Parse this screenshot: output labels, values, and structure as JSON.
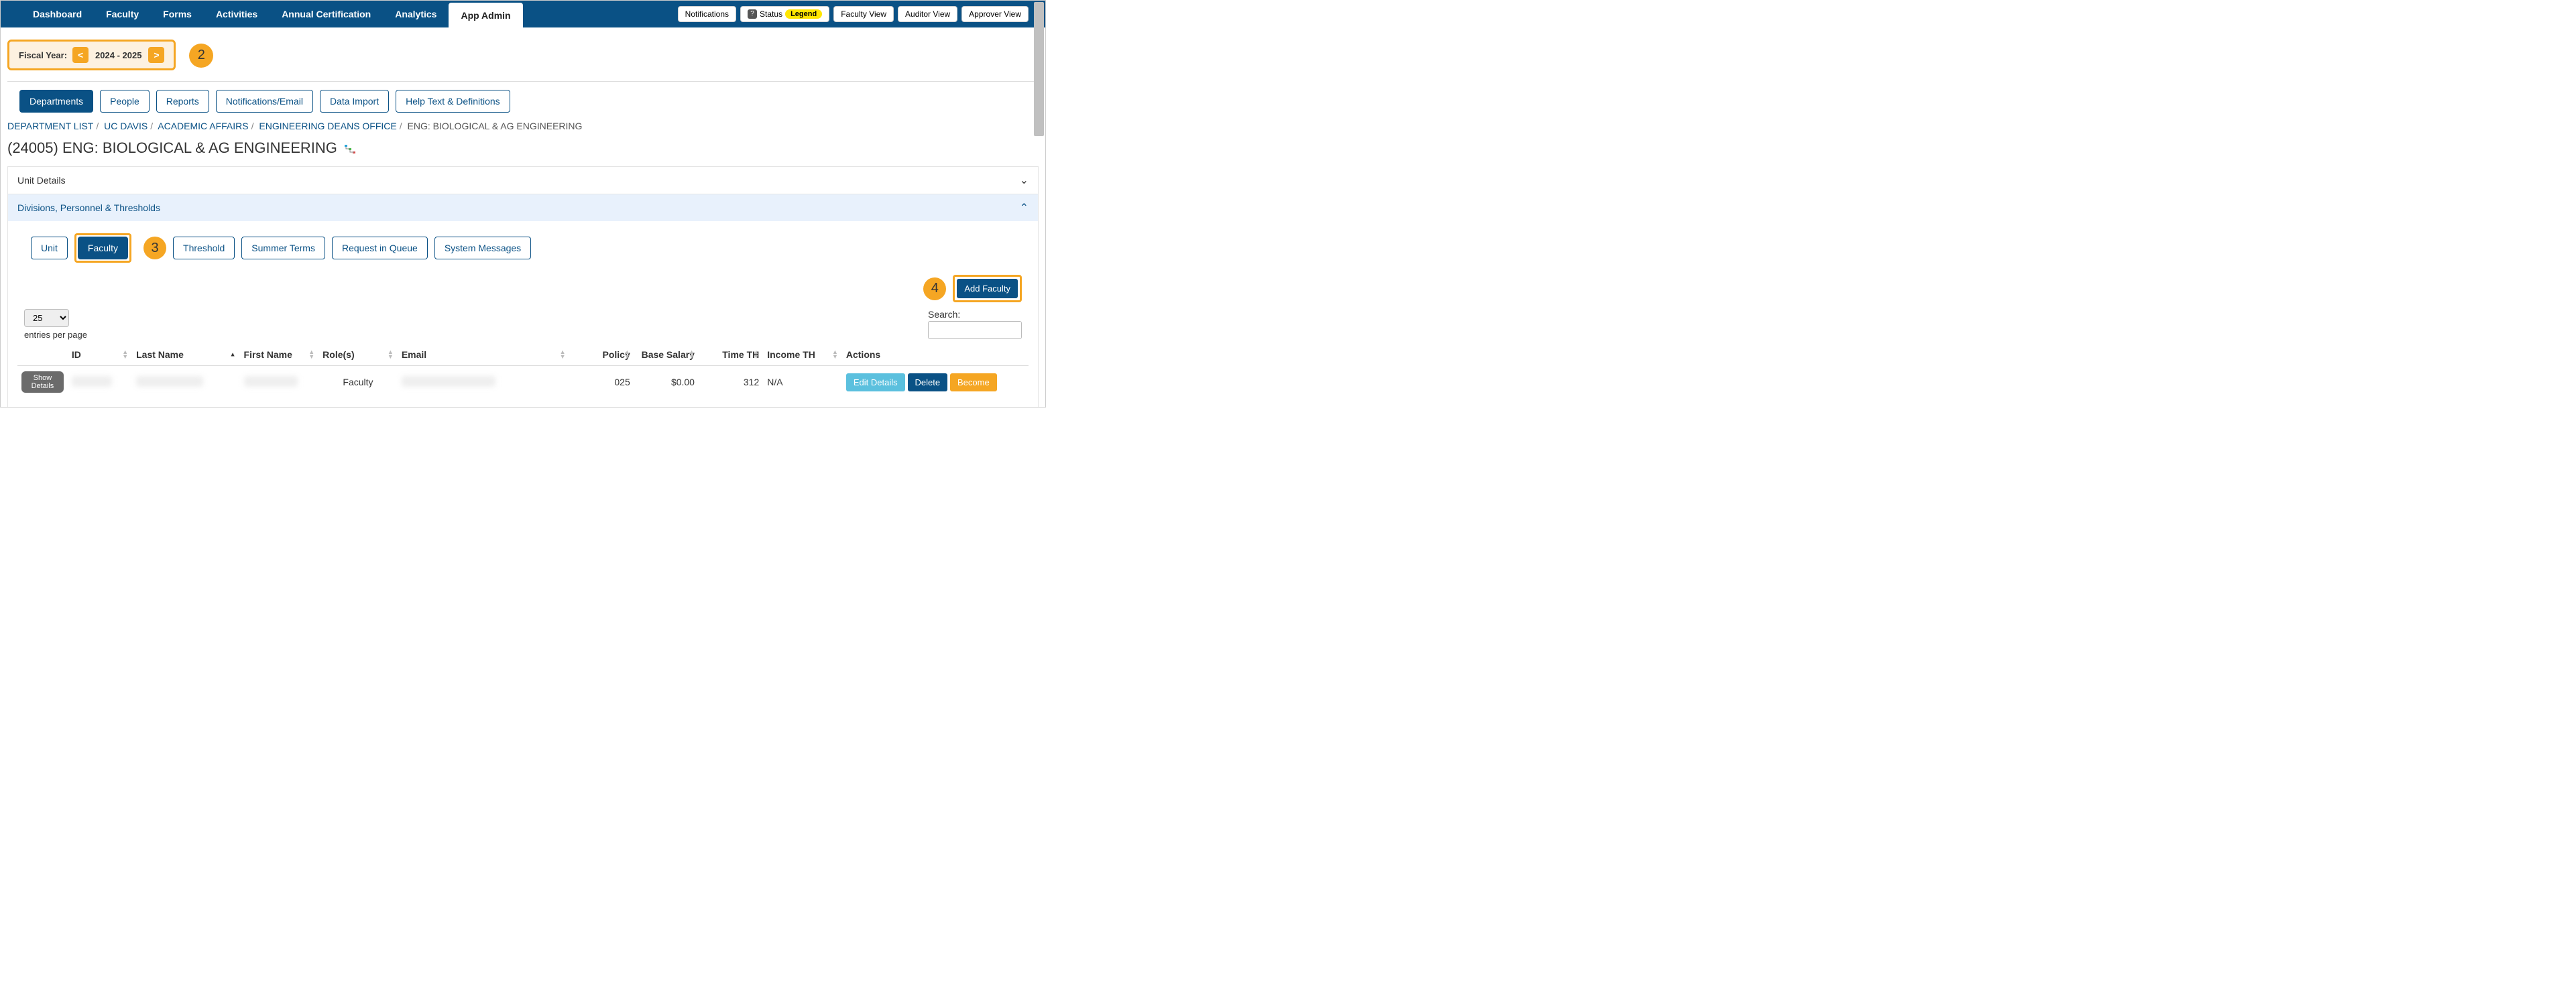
{
  "topnav": {
    "items": [
      "Dashboard",
      "Faculty",
      "Forms",
      "Activities",
      "Annual Certification",
      "Analytics",
      "App Admin"
    ],
    "active_index": 6,
    "right": {
      "notifications": "Notifications",
      "status_label": "Status",
      "legend_label": "Legend",
      "faculty_view": "Faculty View",
      "auditor_view": "Auditor View",
      "approver_view": "Approver View"
    }
  },
  "fiscal_year": {
    "label": "Fiscal Year:",
    "value": "2024 - 2025"
  },
  "annotations": {
    "fy": "2",
    "faculty_tab": "3",
    "add_faculty": "4"
  },
  "subtabs": {
    "items": [
      "Departments",
      "People",
      "Reports",
      "Notifications/Email",
      "Data Import",
      "Help Text & Definitions"
    ],
    "active_index": 0
  },
  "breadcrumb": {
    "items": [
      "DEPARTMENT LIST",
      "UC DAVIS",
      "ACADEMIC AFFAIRS",
      "ENGINEERING DEANS OFFICE",
      "ENG: BIOLOGICAL & AG ENGINEERING"
    ]
  },
  "page_title": "(24005) ENG: BIOLOGICAL & AG ENGINEERING",
  "panels": {
    "unit_details": "Unit Details",
    "dpt": "Divisions, Personnel & Thresholds"
  },
  "innertabs": {
    "items": [
      "Unit",
      "Faculty",
      "Threshold",
      "Summer Terms",
      "Request in Queue",
      "System Messages"
    ],
    "active_index": 1
  },
  "add_faculty_label": "Add Faculty",
  "controls": {
    "page_size_value": "25",
    "page_size_label": "entries per page",
    "search_label": "Search:"
  },
  "table": {
    "columns": [
      "",
      "ID",
      "Last Name",
      "First Name",
      "Role(s)",
      "Email",
      "Policy",
      "Base Salary",
      "Time TH",
      "Income TH",
      "Actions"
    ],
    "row": {
      "show_details": "Show\nDetails",
      "id": "",
      "last_name": "",
      "first_name": "",
      "roles": "Faculty",
      "email": "",
      "policy": "025",
      "base_salary": "$0.00",
      "time_th": "312",
      "income_th": "N/A",
      "actions": {
        "edit": "Edit Details",
        "delete": "Delete",
        "become": "Become"
      }
    }
  }
}
